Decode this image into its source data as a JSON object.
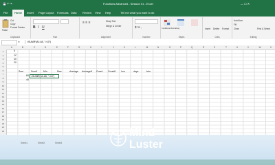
{
  "window": {
    "title": "Functions Advanced - Session 01 - Excel",
    "search_prompt": "Tell me what you want to do",
    "user_button": "Sign in"
  },
  "tabs": [
    "File",
    "Home",
    "Insert",
    "Page Layout",
    "Formulas",
    "Data",
    "Review",
    "View",
    "Help"
  ],
  "active_tab": "Home",
  "ribbon": {
    "clipboard": {
      "paste": "Paste",
      "cut": "Cut",
      "copy": "Copy",
      "format_painter": "Format Painter",
      "label": "Clipboard"
    },
    "font": {
      "label": "Font"
    },
    "alignment": {
      "wrap": "Wrap Text",
      "merge": "Merge & Center",
      "label": "Alignment"
    },
    "number": {
      "label": "Number"
    },
    "styles": {
      "conditional": "Conditional Formatting",
      "table": "Format as Table",
      "cell": "Cell Styles",
      "label": "Styles"
    },
    "cells": {
      "insert": "Insert",
      "delete": "Delete",
      "format": "Format",
      "label": "Cells"
    },
    "editing": {
      "autosum": "AutoSum",
      "fill": "Fill",
      "clear": "Clear",
      "sort": "Sort & Filter",
      "find": "Find & Select",
      "label": "Editing"
    }
  },
  "formula_bar": {
    "name_box": "",
    "fx": "fx",
    "formula": "=SUMIF(A1:A5, \">10\")"
  },
  "columns": [
    "A",
    "B",
    "C",
    "D",
    "E",
    "F",
    "G",
    "H",
    "I",
    "J",
    "K",
    "L",
    "M",
    "N",
    "O",
    "P",
    "Q",
    "R",
    "S",
    "T",
    "U",
    "V",
    "W",
    "X"
  ],
  "rows": [
    "1",
    "2",
    "3",
    "4",
    "5",
    "6",
    "7",
    "8",
    "9",
    "10",
    "11",
    "12",
    "13",
    "14",
    "15",
    "16",
    "17",
    "18",
    "19",
    "20",
    "21",
    "22"
  ],
  "cells": {
    "a1": "5",
    "a2": "12",
    "a3": "40",
    "a4": "20",
    "headers": [
      "Sum",
      "SumIf",
      "Min",
      "Max",
      "Average",
      "AverageIf",
      "Count",
      "CountIf",
      "Len",
      "days",
      "trim"
    ],
    "b7": "80",
    "b8": "40",
    "active_cell": "=SUMIF(A1:A5, \">10\")"
  },
  "sheet_tabs": [
    "Sheet1",
    "Sheet2",
    "Sheet3"
  ],
  "watermark": {
    "line1": "Mind",
    "line2": "Luster"
  },
  "colors": {
    "excel_green": "#217346",
    "bottom_gradient": "#c8dff0"
  }
}
